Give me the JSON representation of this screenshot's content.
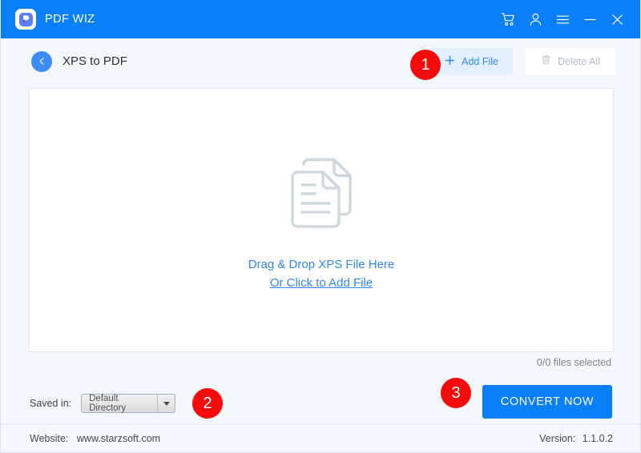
{
  "window": {
    "brand_name": "PDF WIZ",
    "logo_icon": "pdfwiz-logo-icon",
    "controls": [
      {
        "name": "cart-icon",
        "label": "Cart"
      },
      {
        "name": "user-icon",
        "label": "Account"
      },
      {
        "name": "menu-icon",
        "label": "Menu"
      },
      {
        "name": "minimize-icon",
        "label": "Minimize"
      },
      {
        "name": "close-icon",
        "label": "Close"
      }
    ]
  },
  "toolbar": {
    "back_icon": "back-arrow-icon",
    "page_title": "XPS to PDF",
    "add_file_label": "Add File",
    "add_file_icon": "plus-icon",
    "delete_all_label": "Delete All",
    "delete_all_icon": "trash-icon"
  },
  "dropzone": {
    "icon": "documents-icon",
    "line1": "Drag & Drop XPS File Here",
    "line2": "Or Click to Add File",
    "files_selected": "0/0 files selected"
  },
  "bottom": {
    "saved_in_label": "Saved in:",
    "directory_value": "Default Directory",
    "convert_label": "CONVERT NOW"
  },
  "footer": {
    "website_label": "Website:",
    "website_value": "www.starzsoft.com",
    "version_label": "Version:",
    "version_value": "1.1.0.2"
  },
  "badges": [
    {
      "number": "1"
    },
    {
      "number": "2"
    },
    {
      "number": "3"
    }
  ],
  "colors": {
    "brand_blue": "#0a7ffa",
    "badge_red": "#f50b0b",
    "link_blue": "#2f86f6",
    "page_bg": "#f4f7f9"
  }
}
